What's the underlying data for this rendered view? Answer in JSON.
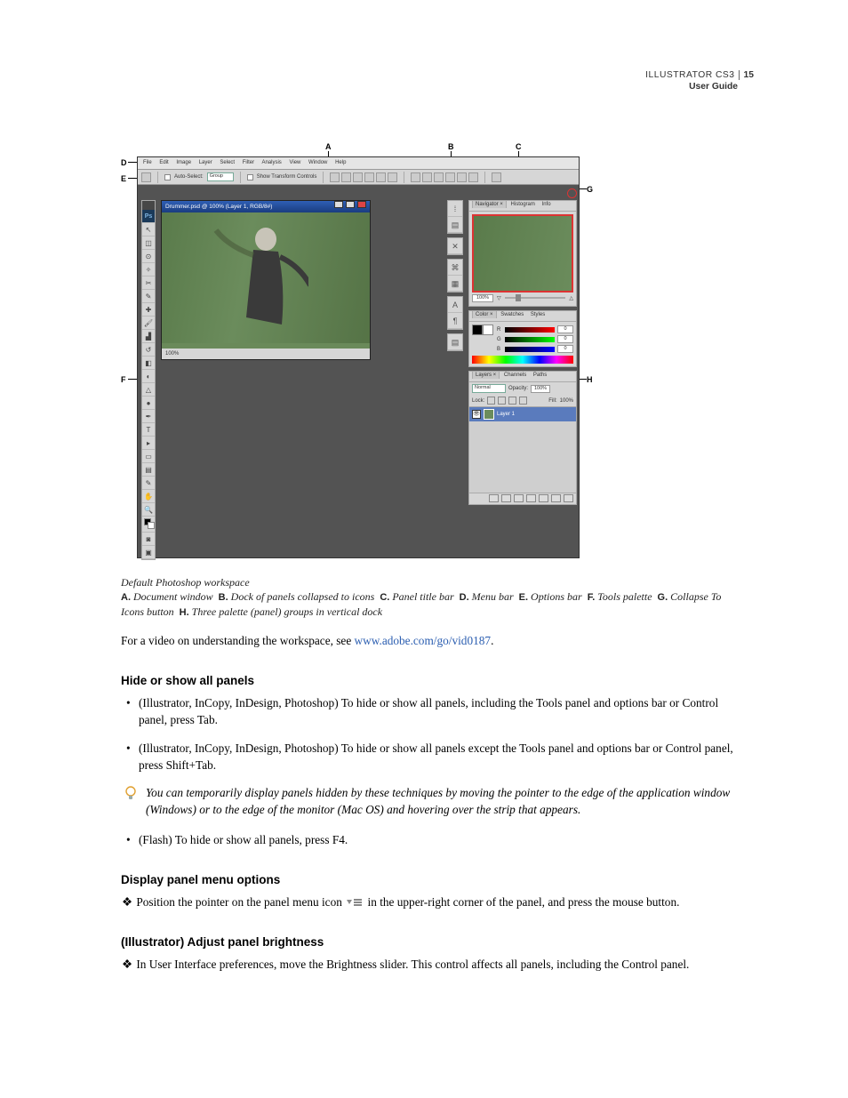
{
  "header": {
    "product": "ILLUSTRATOR CS3",
    "page": "15",
    "guide": "User Guide"
  },
  "callouts": {
    "A": "A",
    "B": "B",
    "C": "C",
    "D": "D",
    "E": "E",
    "F": "F",
    "G": "G",
    "H": "H"
  },
  "screenshot": {
    "menu": [
      "File",
      "Edit",
      "Image",
      "Layer",
      "Select",
      "Filter",
      "Analysis",
      "View",
      "Window",
      "Help"
    ],
    "options": {
      "auto_select": "Auto-Select:",
      "auto_select_value": "Group",
      "show_transform": "Show Transform Controls"
    },
    "doc_title": "Drummer.psd @ 100% (Layer 1, RGB/8#)",
    "doc_zoom": "100%",
    "nav": {
      "tabs": [
        "Navigator ×",
        "Histogram",
        "Info"
      ],
      "zoom": "100%"
    },
    "color": {
      "tabs": [
        "Color ×",
        "Swatches",
        "Styles"
      ],
      "r": "0",
      "g": "0",
      "b": "0"
    },
    "layers": {
      "tabs": [
        "Layers ×",
        "Channels",
        "Paths"
      ],
      "blend": "Normal",
      "opacity_label": "Opacity:",
      "opacity": "100%",
      "lock_label": "Lock:",
      "fill_label": "Fill:",
      "fill": "100%",
      "layer1": "Layer 1"
    }
  },
  "caption": {
    "title": "Default Photoshop workspace",
    "A": "Document window",
    "B": "Dock of panels collapsed to icons",
    "C": "Panel title bar",
    "D": "Menu bar",
    "E": "Options bar",
    "F": "Tools palette",
    "G": "Collapse To Icons button",
    "H": "Three palette (panel) groups in vertical dock"
  },
  "paragraphs": {
    "video_pre": "For a video on understanding the workspace, see ",
    "video_link": "www.adobe.com/go/vid0187",
    "video_post": "."
  },
  "sections": {
    "hide": {
      "title": "Hide or show all panels",
      "b1": "(Illustrator, InCopy, InDesign, Photoshop) To hide or show all panels, including the Tools panel and options bar or Control panel, press Tab.",
      "b2": "(Illustrator, InCopy, InDesign, Photoshop) To hide or show all panels except the Tools panel and options bar or Control panel, press Shift+Tab.",
      "tip": "You can temporarily display panels hidden by these techniques by moving the pointer to the edge of the application window (Windows) or to the edge of the monitor (Mac OS) and hovering over the strip that appears.",
      "b3": "(Flash) To hide or show all panels, press F4."
    },
    "menu": {
      "title": "Display panel menu options",
      "text_pre": "Position the pointer on the panel menu icon ",
      "text_post": " in the upper-right corner of the panel, and press the mouse button."
    },
    "brightness": {
      "title": "(Illustrator) Adjust panel brightness",
      "text": "In User Interface preferences, move the Brightness slider. This control affects all panels, including the Control panel."
    }
  }
}
